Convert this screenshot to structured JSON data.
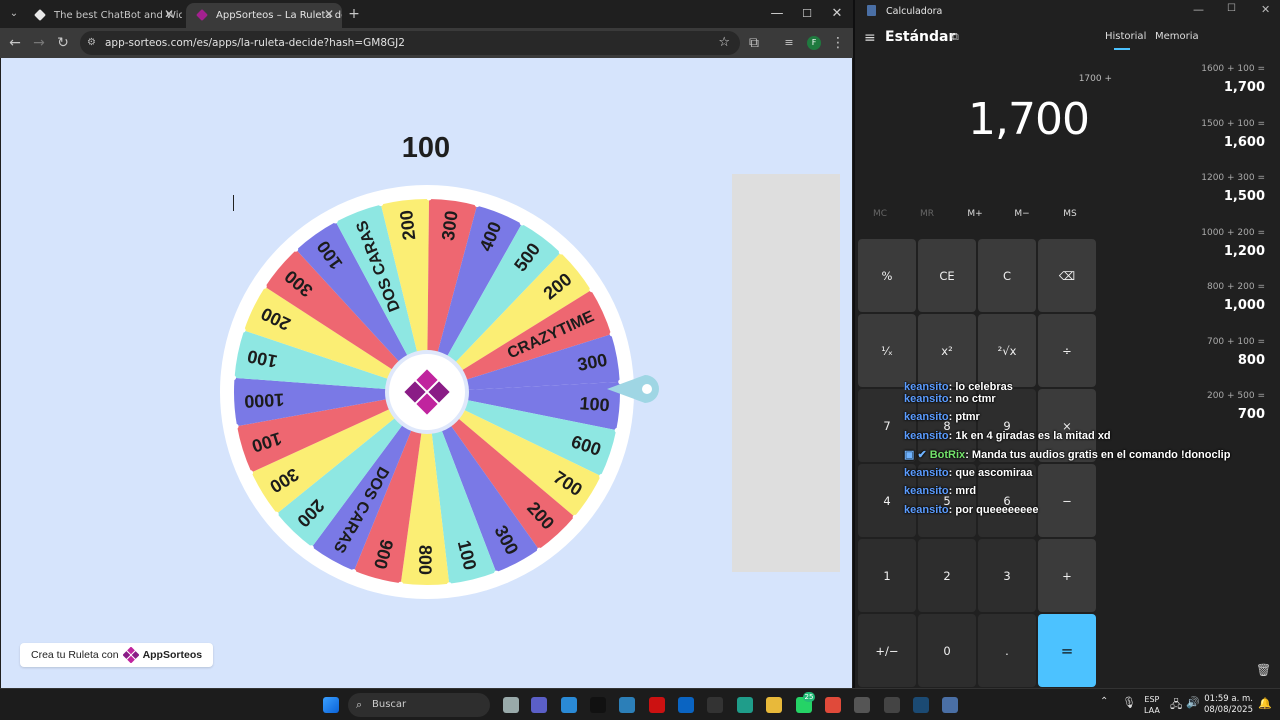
{
  "browser": {
    "tabs": [
      {
        "title": "The best ChatBot and Widgets"
      },
      {
        "title": "AppSorteos – La Ruleta de"
      }
    ],
    "url": "app-sorteos.com/es/apps/la-ruleta-decide?hash=GM8GJ2",
    "profile_letter": "F"
  },
  "roulette": {
    "result": "100",
    "segments": [
      "100",
      "600",
      "700",
      "200",
      "300",
      "100",
      "800",
      "900",
      "DOS CARAS",
      "200",
      "300",
      "100",
      "1000",
      "100",
      "200",
      "300",
      "100",
      "DOS CARAS",
      "200",
      "300",
      "400",
      "500",
      "200",
      "CRAZYTIME",
      "300"
    ],
    "credit_text": "Crea tu Ruleta con",
    "credit_brand": "AppSorteos"
  },
  "calculator": {
    "window_title": "Calculadora",
    "mode": "Estándar",
    "tab_history": "Historial",
    "tab_memory": "Memoria",
    "expression": "1700 +",
    "display": "1,700",
    "memory_buttons": [
      "MC",
      "MR",
      "M+",
      "M−",
      "MS"
    ],
    "keys": [
      "%",
      "CE",
      "C",
      "⌫",
      "¹⁄ₓ",
      "x²",
      "²√x",
      "÷",
      "7",
      "8",
      "9",
      "×",
      "4",
      "5",
      "6",
      "−",
      "1",
      "2",
      "3",
      "+",
      "+/−",
      "0",
      ".",
      "="
    ],
    "history": [
      {
        "expr": "1600  +  100 =",
        "result": "1,700"
      },
      {
        "expr": "1500  +  100 =",
        "result": "1,600"
      },
      {
        "expr": "1200  +  300 =",
        "result": "1,500"
      },
      {
        "expr": "1000  +  200 =",
        "result": "1,200"
      },
      {
        "expr": "800  +  200 =",
        "result": "1,000"
      },
      {
        "expr": "700  +  100 =",
        "result": "800"
      },
      {
        "expr": "200  +  500 =",
        "result": "700"
      }
    ]
  },
  "chat": [
    {
      "user": "keansito",
      "msg": ": lo celebras"
    },
    {
      "user": "keansito",
      "msg": ": no ctmr"
    },
    {
      "user": "keansito",
      "msg": ": ptmr"
    },
    {
      "user": "keansito",
      "msg": ": 1k en 4 giradas es la mitad xd"
    },
    {
      "user": "BotRix",
      "msg": ": Manda tus audios gratis en el comando !donoclip"
    },
    {
      "user": "keansito",
      "msg": ": que ascomiraa"
    },
    {
      "user": "keansito",
      "msg": ": mrd"
    },
    {
      "user": "keansito",
      "msg": ": por queeeeeeee"
    }
  ],
  "taskbar": {
    "search_placeholder": "Buscar",
    "lang": "ESP",
    "lang_sub": "LAA",
    "time": "01:59 a. m.",
    "date": "08/08/2025",
    "whatsapp_badge": "25"
  }
}
